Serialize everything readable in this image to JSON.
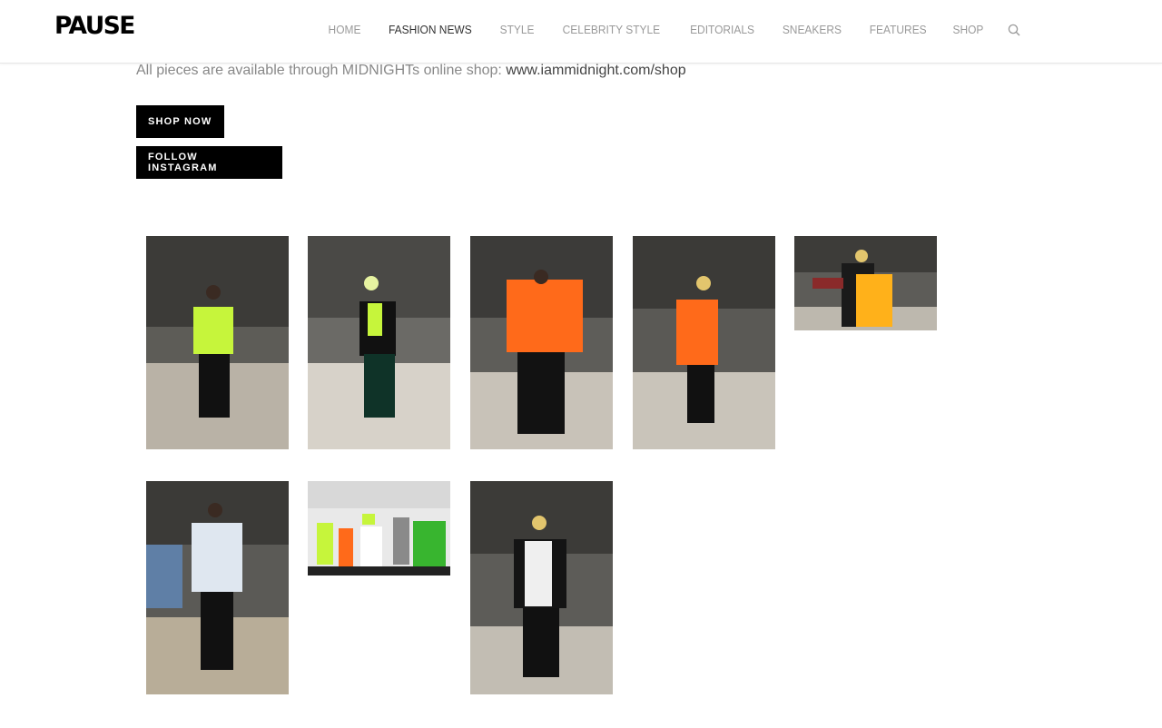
{
  "header": {
    "logo": "PAUSE",
    "nav": [
      "HOME",
      "FASHION NEWS",
      "STYLE",
      "CELEBRITY STYLE",
      "EDITORIALS",
      "SNEAKERS",
      "FEATURES",
      "SHOP"
    ],
    "active_nav": "FASHION NEWS",
    "search_icon": "search-icon"
  },
  "intro": {
    "text": "All pieces are available through MIDNIGHTs online shop: ",
    "link": "www.iammidnight.com/shop"
  },
  "buttons": {
    "shop": "SHOP NOW",
    "instagram": "FOLLOW INSTAGRAM"
  },
  "colors": {
    "accent_neon": "#c6f53b",
    "accent_orange": "#ff6a1a",
    "button_bg": "#000000"
  }
}
